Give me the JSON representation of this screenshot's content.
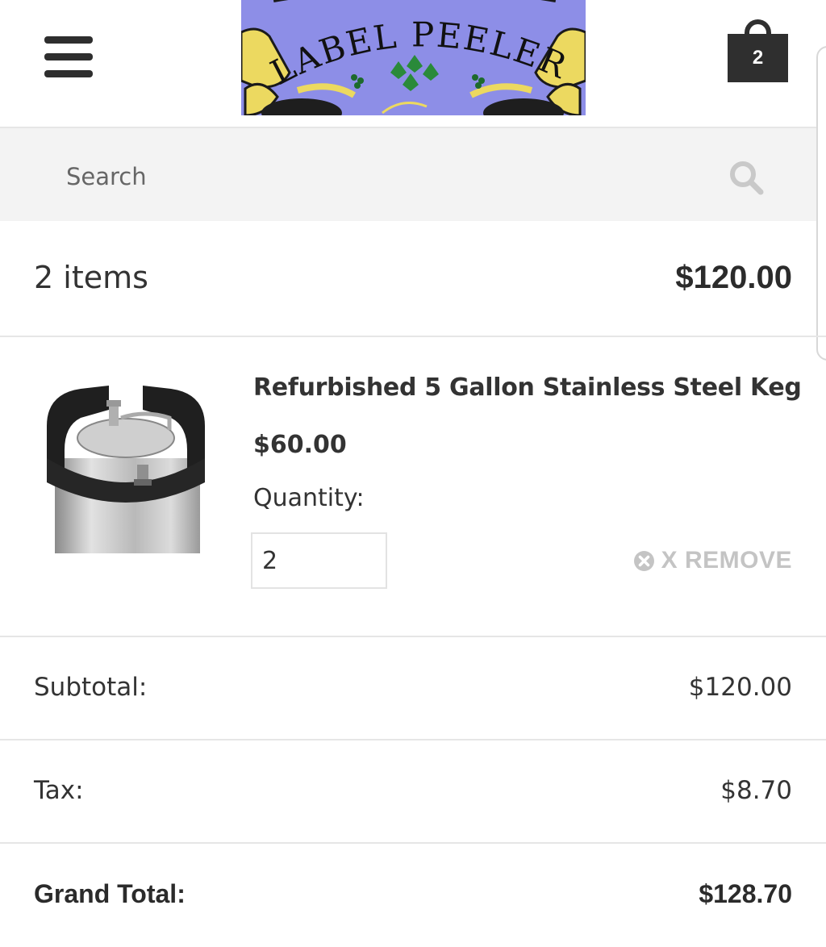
{
  "header": {
    "logo_text": "LABEL PEELERS",
    "cart_count": "2"
  },
  "search": {
    "placeholder": "Search"
  },
  "summary": {
    "items_label": "2 items",
    "total": "$120.00"
  },
  "product": {
    "name": "Refurbished 5 Gallon Stainless Steel Keg",
    "price": "$60.00",
    "quantity_label": "Quantity:",
    "quantity_value": "2",
    "remove_label": "X REMOVE"
  },
  "totals": {
    "subtotal_label": "Subtotal:",
    "subtotal_value": "$120.00",
    "tax_label": "Tax:",
    "tax_value": "$8.70",
    "grand_label": "Grand Total:",
    "grand_value": "$128.70"
  },
  "colors": {
    "dark": "#2f2f2f",
    "search_bg": "#f3f3f3",
    "divider": "#e6e6e6",
    "remove": "#c4c4c4",
    "logo_purple": "#8c8ce6",
    "logo_gold": "#e8d44a"
  }
}
